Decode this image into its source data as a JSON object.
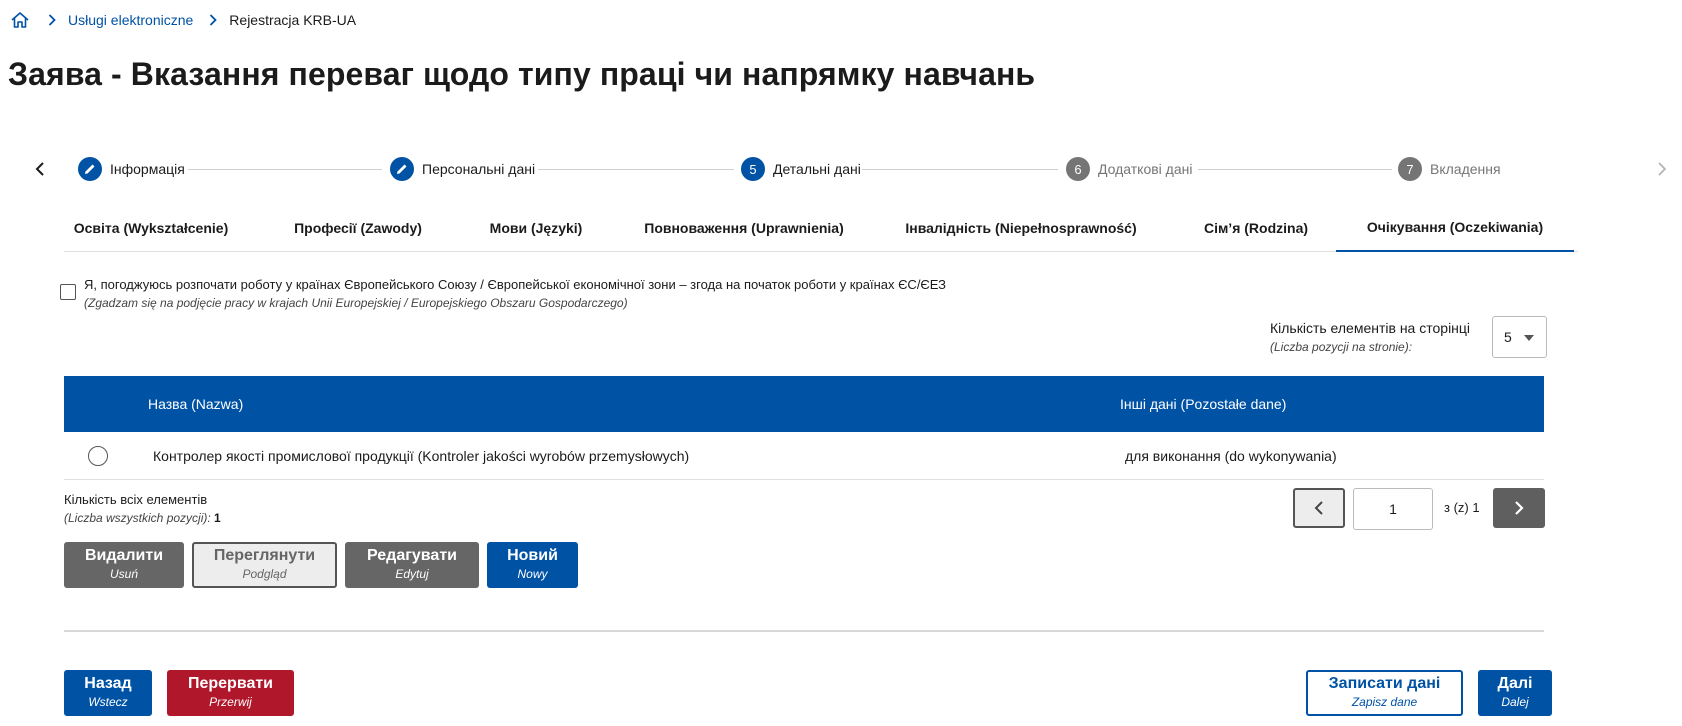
{
  "breadcrumb": {
    "items": [
      "Usługi elektroniczne",
      "Rejestracja KRB-UA"
    ]
  },
  "page_title": "Заява - Вказання переваг щодо типу праці чи напрямку навчань",
  "stepper": {
    "steps": [
      {
        "label": "Інформація",
        "state": "done"
      },
      {
        "label": "Персональні дані",
        "state": "done"
      },
      {
        "number": "5",
        "label": "Детальні дані",
        "state": "current"
      },
      {
        "number": "6",
        "label": "Додаткові дані",
        "state": "todo"
      },
      {
        "number": "7",
        "label": "Вкладення",
        "state": "todo"
      }
    ]
  },
  "tabs": [
    {
      "label": "Освіта (Wykształcenie)"
    },
    {
      "label": "Професії (Zawody)"
    },
    {
      "label": "Мови (Języki)"
    },
    {
      "label": "Повноваження (Uprawnienia)"
    },
    {
      "label": "Інвалідність (Niepełnosprawność)"
    },
    {
      "label": "Сім’я (Rodzina)"
    },
    {
      "label": "Очікування (Oczekiwania)",
      "active": true
    }
  ],
  "consent": {
    "label": "Я, погоджуюсь розпочати роботу у країнах Європейського Союзу / Європейської економічної зони – згода на початок роботи у країнах ЄС/ЄЕЗ",
    "label_pl": "(Zgadzam się na podjęcie pracy w krajach Unii Europejskiej / Europejskiego Obszaru Gospodarczego)",
    "checked": false
  },
  "per_page": {
    "label": "Кількість елементів на сторінці",
    "label_pl": "(Liczba pozycji na stronie):",
    "value": "5"
  },
  "table": {
    "headers": [
      "Назва (Nazwa)",
      "Інші дані (Pozostałe dane)"
    ],
    "rows": [
      {
        "name": "Контролер якості промислової продукції (Kontroler jakości wyrobów przemysłowych)",
        "other": "для виконання (do wykonywania)"
      }
    ]
  },
  "total": {
    "label": "Кількість всіх елементів",
    "label_pl": "(Liczba wszystkich pozycji):",
    "value": "1"
  },
  "pager": {
    "page": "1",
    "of_label": "з (z) 1"
  },
  "actions": {
    "delete": {
      "label": "Видалити",
      "sub": "Usuń"
    },
    "view": {
      "label": "Переглянути",
      "sub": "Podgląd"
    },
    "edit": {
      "label": "Редагувати",
      "sub": "Edytuj"
    },
    "new": {
      "label": "Новий",
      "sub": "Nowy"
    }
  },
  "footer": {
    "back": {
      "label": "Назад",
      "sub": "Wstecz"
    },
    "abort": {
      "label": "Перервати",
      "sub": "Przerwij"
    },
    "save": {
      "label": "Записати дані",
      "sub": "Zapisz dane"
    },
    "next": {
      "label": "Далі",
      "sub": "Dalej"
    }
  },
  "colors": {
    "primary": "#0052a5",
    "danger": "#b0172a",
    "neutral": "#666666"
  }
}
